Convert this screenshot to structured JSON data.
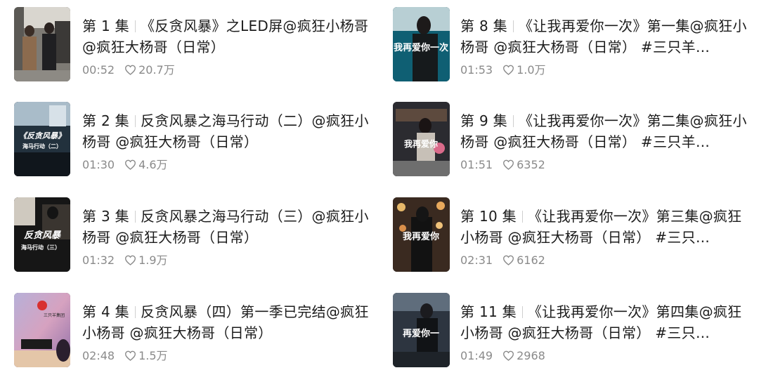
{
  "colors": {
    "text": "#1c1c1c",
    "meta": "#8a8a8a",
    "separator": "#cfcfcf"
  },
  "left": [
    {
      "episode": "第 1 集",
      "title": "《反贪风暴》之LED屏@疯狂小杨哥 @疯狂大杨哥（日常）",
      "duration": "00:52",
      "likes": "20.7万",
      "thumb_text": ""
    },
    {
      "episode": "第 2 集",
      "title": "反贪风暴之海马行动（二）@疯狂小杨哥 @疯狂大杨哥（日常）",
      "duration": "01:30",
      "likes": "4.6万",
      "thumb_text": "《反贪风暴》",
      "thumb_sub": "海马行动（二）"
    },
    {
      "episode": "第 3 集",
      "title": "反贪风暴之海马行动（三）@疯狂小杨哥 @疯狂大杨哥（日常）",
      "duration": "01:32",
      "likes": "1.9万",
      "thumb_text": "反贪风暴",
      "thumb_sub": "海马行动（三）"
    },
    {
      "episode": "第 4 集",
      "title": "反贪风暴（四）第一季已完结@疯狂小杨哥 @疯狂大杨哥（日常）",
      "duration": "02:48",
      "likes": "1.5万",
      "thumb_text": "三只羊集团"
    }
  ],
  "right": [
    {
      "episode": "第 8 集",
      "title": "《让我再爱你一次》第一集@疯狂小杨哥 @疯狂大杨哥（日常） #三只羊…",
      "duration": "01:53",
      "likes": "1.0万",
      "thumb_text": "我再爱你一次"
    },
    {
      "episode": "第 9 集",
      "title": "《让我再爱你一次》第二集@疯狂小杨哥 @疯狂大杨哥（日常） #三只羊…",
      "duration": "01:51",
      "likes": "6352",
      "thumb_text": "我再爱你"
    },
    {
      "episode": "第 10 集",
      "title": "《让我再爱你一次》第三集@疯狂小杨哥 @疯狂大杨哥（日常） #三只…",
      "duration": "02:31",
      "likes": "6162",
      "thumb_text": "我再爱你"
    },
    {
      "episode": "第 11 集",
      "title": "《让我再爱你一次》第四集@疯狂小杨哥 @疯狂大杨哥（日常） #三只…",
      "duration": "01:49",
      "likes": "2968",
      "thumb_text": "再爱你一"
    }
  ]
}
